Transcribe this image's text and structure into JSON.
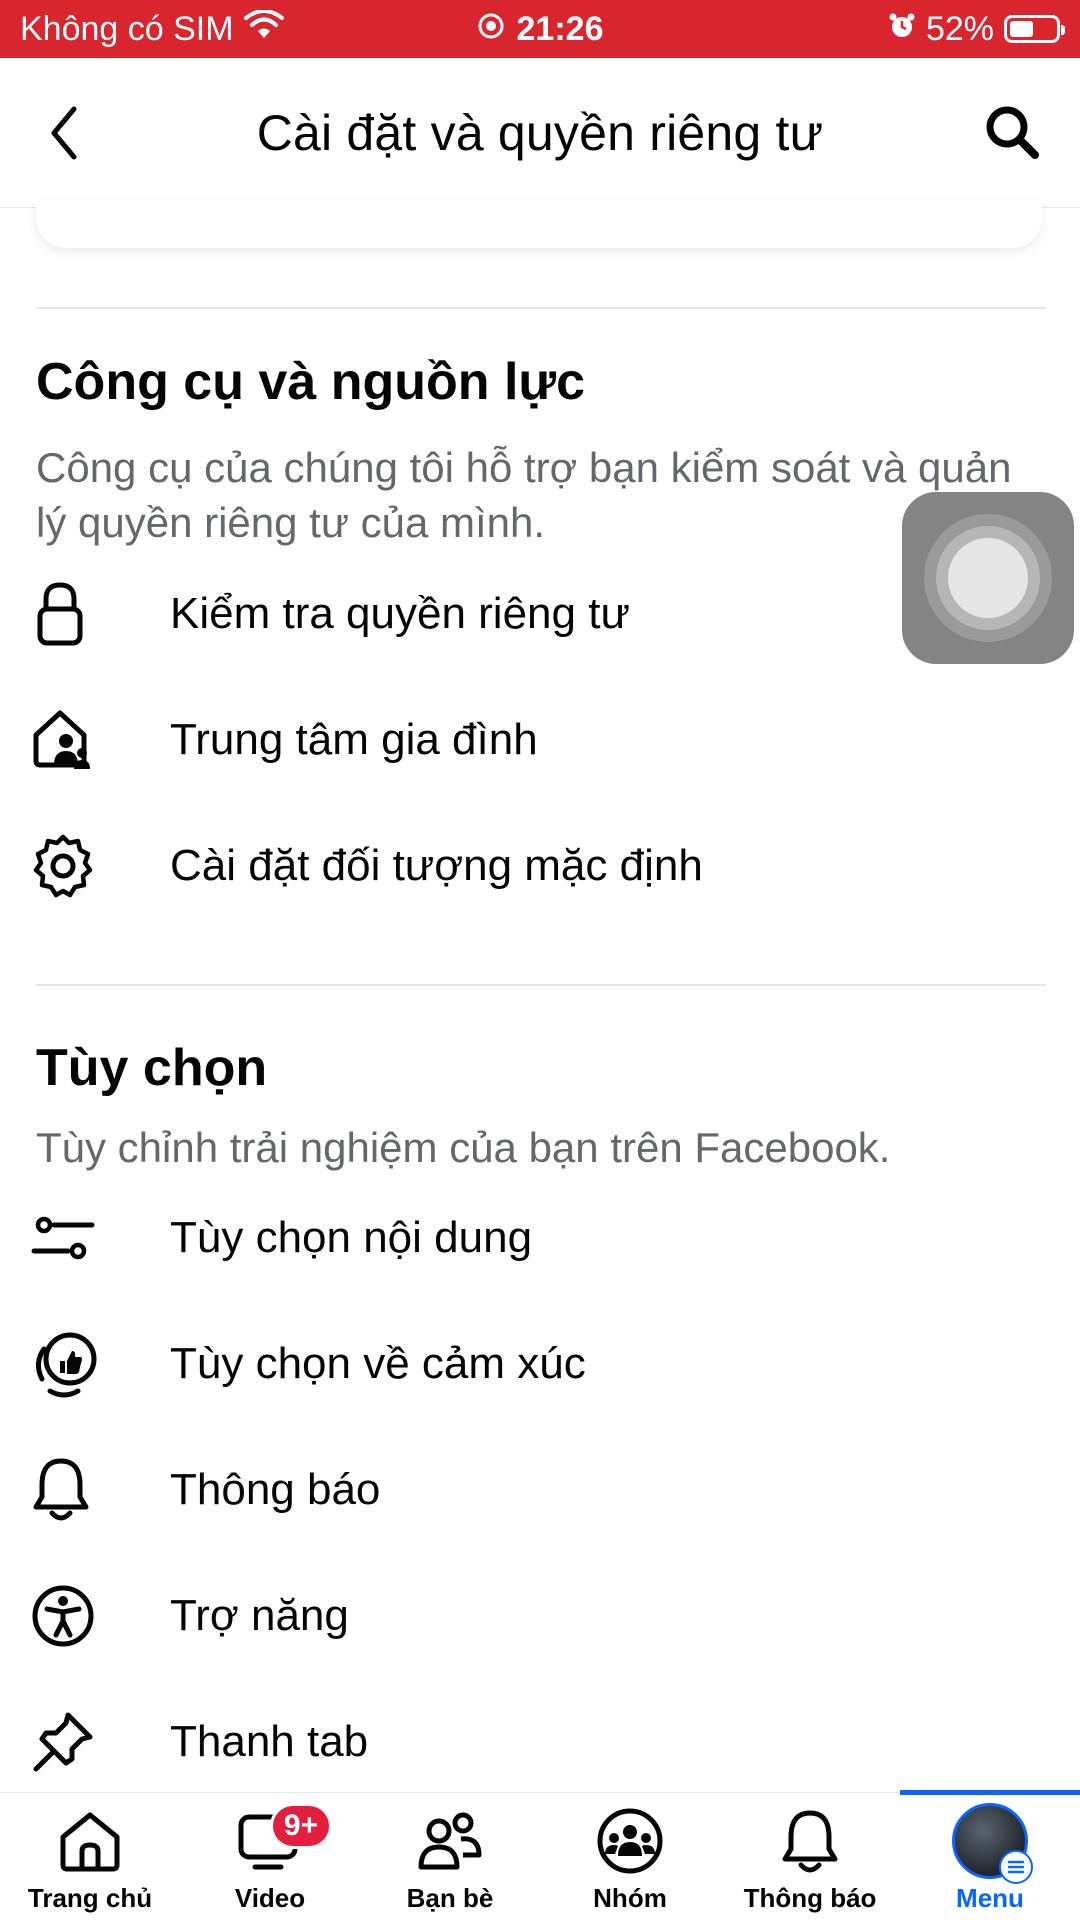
{
  "status_bar": {
    "carrier": "Không có SIM",
    "time": "21:26",
    "battery_percent": "52%",
    "battery_level": 0.52,
    "background_color": "#d9252e"
  },
  "header": {
    "title": "Cài đặt và quyền riêng tư",
    "back_icon": "chevron-left-icon",
    "search_icon": "search-icon"
  },
  "sections": {
    "tools": {
      "title": "Công cụ và nguồn lực",
      "description": "Công cụ của chúng tôi hỗ trợ bạn kiểm soát và quản lý quyền riêng tư của mình.",
      "items": [
        {
          "label": "Kiểm tra quyền riêng tư",
          "icon": "lock-icon"
        },
        {
          "label": "Trung tâm gia đình",
          "icon": "family-house-icon"
        },
        {
          "label": "Cài đặt đối tượng mặc định",
          "icon": "gear-icon"
        }
      ]
    },
    "preferences": {
      "title": "Tùy chọn",
      "description": "Tùy chỉnh trải nghiệm của bạn trên Facebook.",
      "items": [
        {
          "label": "Tùy chọn nội dung",
          "icon": "sliders-icon"
        },
        {
          "label": "Tùy chọn về cảm xúc",
          "icon": "reaction-icon"
        },
        {
          "label": "Thông báo",
          "icon": "bell-icon"
        },
        {
          "label": "Trợ năng",
          "icon": "accessibility-icon"
        },
        {
          "label": "Thanh tab",
          "icon": "pin-icon"
        }
      ]
    }
  },
  "tab_bar": {
    "tabs": [
      {
        "label": "Trang chủ",
        "icon": "home-icon"
      },
      {
        "label": "Video",
        "icon": "video-icon",
        "badge": "9+"
      },
      {
        "label": "Bạn bè",
        "icon": "friends-icon"
      },
      {
        "label": "Nhóm",
        "icon": "groups-icon"
      },
      {
        "label": "Thông báo",
        "icon": "bell-icon"
      },
      {
        "label": "Menu",
        "icon": "avatar-menu-icon",
        "active": true
      }
    ],
    "accent_color": "#0866ff",
    "badge_color": "#e41e3f"
  }
}
